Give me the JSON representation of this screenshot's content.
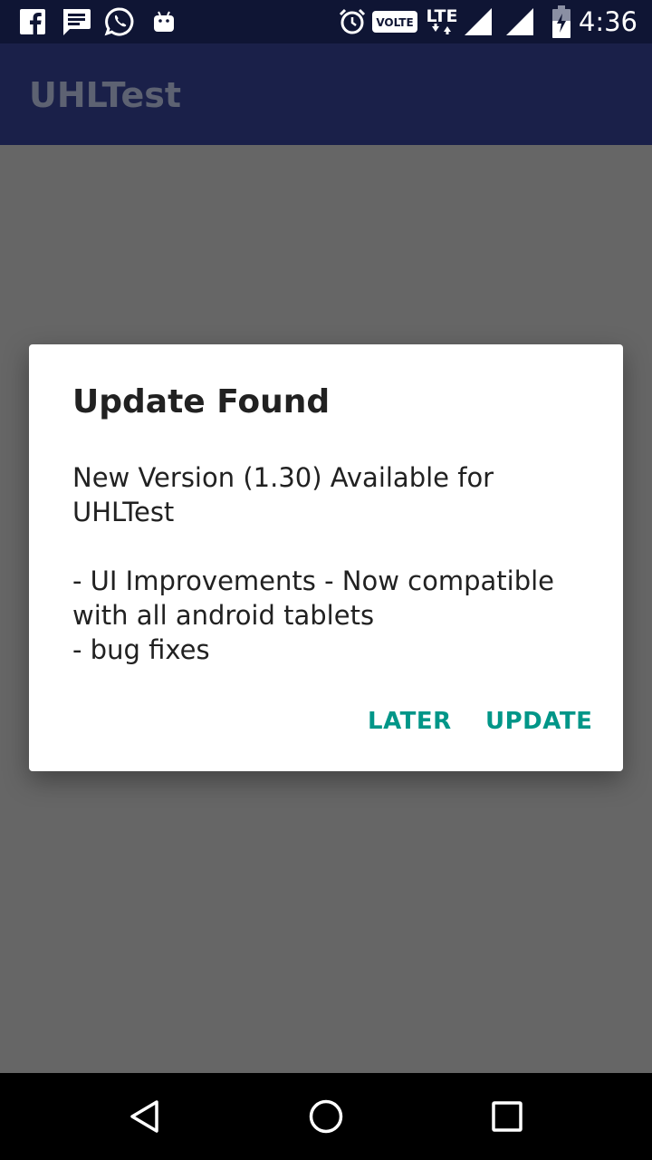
{
  "status_bar": {
    "time": "4:36",
    "volte_label": "VOLTE",
    "network_label": "LTE",
    "left_icons": [
      "facebook-icon",
      "message-icon",
      "whatsapp-icon",
      "android-icon"
    ],
    "right_icons": [
      "alarm-icon",
      "volte-icon",
      "lte-icon",
      "signal-icon",
      "signal-icon",
      "battery-icon"
    ]
  },
  "app_bar": {
    "title": "UHLTest"
  },
  "dialog": {
    "title": "Update Found",
    "message": "New Version (1.30) Available for UHLTest\n\n- UI Improvements - Now compatible with all android tablets\n- bug fixes",
    "later_label": "LATER",
    "update_label": "UPDATE"
  },
  "nav_bar": {
    "buttons": [
      "back-icon",
      "home-icon",
      "recents-icon"
    ]
  },
  "colors": {
    "status_bar": "#0f1534",
    "app_bar": "#1a2049",
    "scrim": "#666666",
    "accent": "#009688"
  }
}
